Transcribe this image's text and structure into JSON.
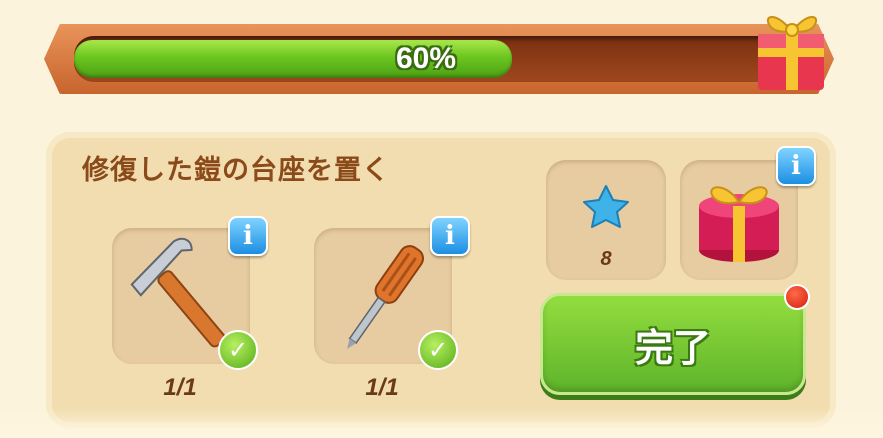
{
  "progress": {
    "label": "60%",
    "value": 0.6
  },
  "quest": {
    "title": "修復した鎧の台座を置く"
  },
  "requirements": [
    {
      "name": "hammer",
      "count": "1/1"
    },
    {
      "name": "screwdriver",
      "count": "1/1"
    }
  ],
  "rewards": {
    "star": {
      "count": "8"
    },
    "gift": {}
  },
  "buttons": {
    "info": "i",
    "done": "完了"
  },
  "colors": {
    "progress_fill": "#6cc61f",
    "frame": "#c8642e",
    "done_button": "#6fc22f",
    "title_text": "#8a4a1a",
    "info_button": "#1c8fe3",
    "notification_dot": "#d41d0c"
  },
  "icons": [
    "gift-icon",
    "hammer-icon",
    "screwdriver-icon",
    "star-icon",
    "round-gift-icon",
    "info-icon",
    "check-icon"
  ]
}
